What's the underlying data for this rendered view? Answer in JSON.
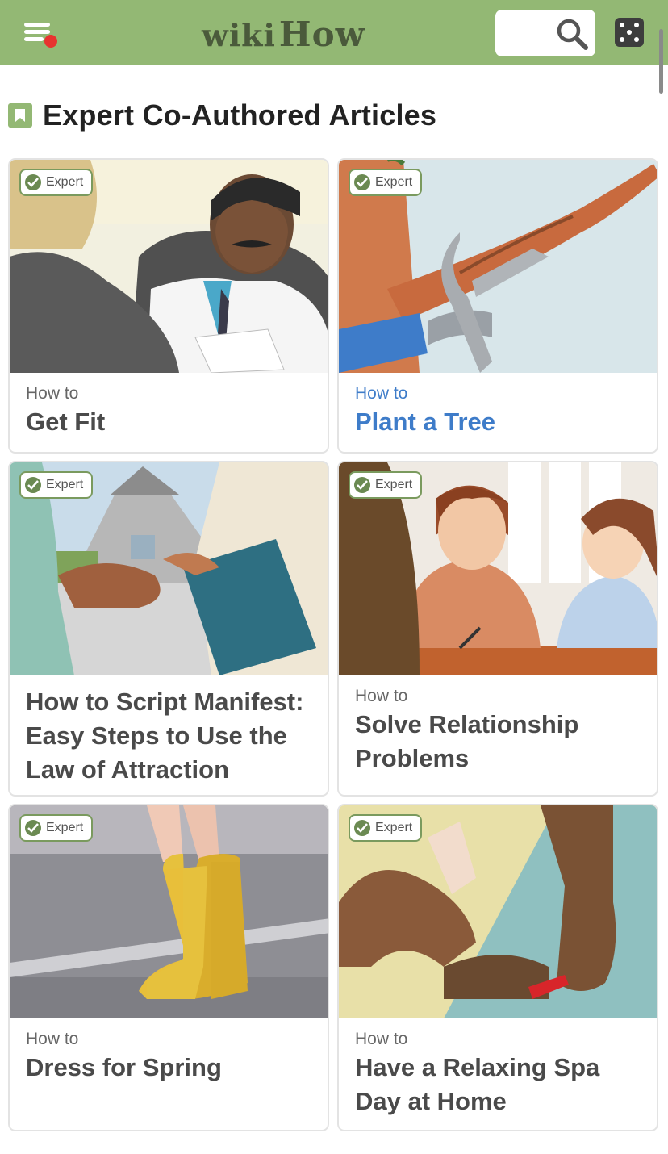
{
  "header": {
    "logo_wiki": "wiki",
    "logo_how": "How",
    "menu_icon": "hamburger-menu-icon",
    "search_icon": "search-icon",
    "random_icon": "dice-icon",
    "bar_color": "#93b874"
  },
  "section": {
    "title": "Expert Co-Authored Articles",
    "icon": "bookmark-icon"
  },
  "badge_label": "Expert",
  "articles": [
    {
      "prefix": "How to",
      "title": "Get Fit"
    },
    {
      "prefix": "How to",
      "title": "Plant a Tree",
      "state": "highlighted"
    },
    {
      "prefix": "",
      "title": "How to Script Manifest: Easy Steps to Use the Law of Attraction"
    },
    {
      "prefix": "How to",
      "title": "Solve Relationship Problems"
    },
    {
      "prefix": "How to",
      "title": "Dress for Spring"
    },
    {
      "prefix": "How to",
      "title": "Have a Relaxing Spa Day at Home"
    }
  ],
  "colors": {
    "link_blue": "#3e7cc9",
    "accent_green": "#93b874",
    "notification_red": "#e8332f"
  }
}
